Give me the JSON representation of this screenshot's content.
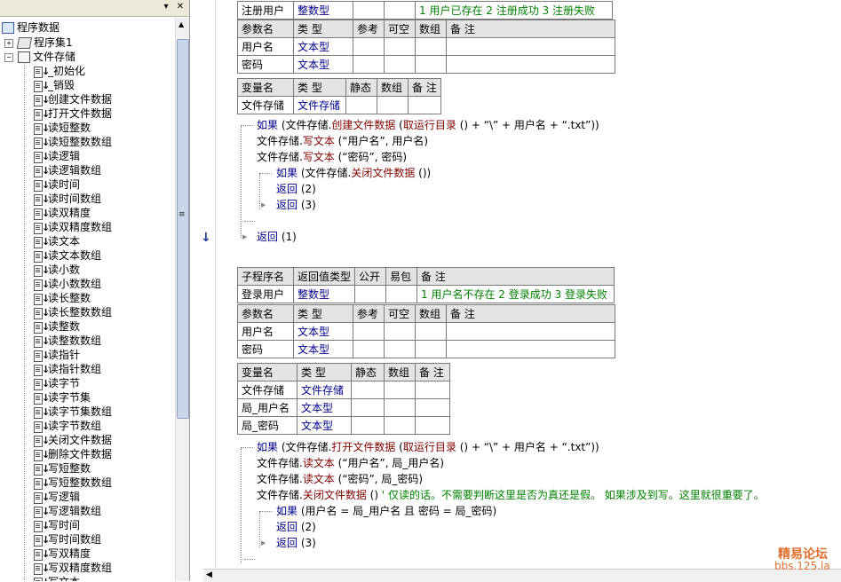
{
  "tree": {
    "root_label": "程序数据",
    "assembly_label": "程序集1",
    "file_storage_label": "文件存储",
    "items": [
      "_初始化",
      "_销毁",
      "创建文件数据",
      "打开文件数据",
      "读短整数",
      "读短整数数组",
      "读逻辑",
      "读逻辑数组",
      "读时间",
      "读时间数组",
      "读双精度",
      "读双精度数组",
      "读文本",
      "读文本数组",
      "读小数",
      "读小数数组",
      "读长整数",
      "读长整数数组",
      "读整数",
      "读整数数组",
      "读指针",
      "读指针数组",
      "读字节",
      "读字节集",
      "读字节集数组",
      "读字节数组",
      "关闭文件数据",
      "删除文件数据",
      "写短整数",
      "写短整数数组",
      "写逻辑",
      "写逻辑数组",
      "写时间",
      "写时间数组",
      "写双精度",
      "写双精度数组",
      "写文本"
    ]
  },
  "sub1": {
    "row_name": "注册用户",
    "row_type": "整数型",
    "row_note": "1 用户已存在  2 注册成功  3 注册失败",
    "param_headers": [
      "参数名",
      "类 型",
      "参考",
      "可空",
      "数组",
      "备 注"
    ],
    "params": [
      [
        "用户名",
        "文本型"
      ],
      [
        "密码",
        "文本型"
      ]
    ],
    "var_headers": [
      "变量名",
      "类 型",
      "静态",
      "数组",
      "备 注"
    ],
    "vars": [
      [
        "文件存储",
        "文件存储"
      ]
    ],
    "code": {
      "l1_kw": "如果",
      "l1_a": "(文件存储.",
      "l1_fn": "创建文件数据",
      "l1_b": " (",
      "l1_fn2": "取运行目录",
      "l1_c": " () + “\\” + 用户名 + “.txt”))",
      "l2_a": "文件存储.",
      "l2_fn": "写文本",
      "l2_b": " (“用户名”, 用户名)",
      "l3_a": "文件存储.",
      "l3_fn": "写文本",
      "l3_b": " (“密码”, 密码)",
      "l4_kw": "如果",
      "l4_a": " (文件存储.",
      "l4_fn": "关闭文件数据",
      "l4_b": " ())",
      "l5_kw": "返回",
      "l5_a": " (2)",
      "l6_kw": "返回",
      "l6_a": " (3)",
      "l7_kw": "返回",
      "l7_a": " (1)"
    }
  },
  "sub2": {
    "header": [
      "子程序名",
      "返回值类型",
      "公开",
      "易包",
      "备 注"
    ],
    "row_name": "登录用户",
    "row_type": "整数型",
    "row_note": "1 用户名不存在 2 登录成功 3 登录失败",
    "param_headers": [
      "参数名",
      "类 型",
      "参考",
      "可空",
      "数组",
      "备 注"
    ],
    "params": [
      [
        "用户名",
        "文本型"
      ],
      [
        "密码",
        "文本型"
      ]
    ],
    "var_headers": [
      "变量名",
      "类 型",
      "静态",
      "数组",
      "备 注"
    ],
    "vars": [
      [
        "文件存储",
        "文件存储"
      ],
      [
        "局_用户名",
        "文本型"
      ],
      [
        "局_密码",
        "文本型"
      ]
    ],
    "code": {
      "l1_kw": "如果",
      "l1_a": "(文件存储.",
      "l1_fn": "打开文件数据",
      "l1_b": " (",
      "l1_fn2": "取运行目录",
      "l1_c": " () + “\\” + 用户名 + “.txt”))",
      "l2_a": "文件存储.",
      "l2_fn": "读文本",
      "l2_b": " (“用户名”, 局_用户名)",
      "l3_a": "文件存储.",
      "l3_fn": "读文本",
      "l3_b": " (“密码”, 局_密码)",
      "l4_a": "文件存储.",
      "l4_fn": "关闭文件数据",
      "l4_b": " () ",
      "l4_cm": "' 仅读的话。不需要判断这里是否为真还是假。 如果涉及到写。这里就很重要了。",
      "l5_kw": "如果",
      "l5_a": " (用户名 = 局_用户名 且 密码 = 局_密码)",
      "l6_kw": "返回",
      "l6_a": " (2)",
      "l7_kw": "返回",
      "l7_a": " (3)"
    }
  },
  "watermark": {
    "line1": "精易论坛",
    "line2": "bbs.125.la"
  },
  "colors": {
    "keyword": "#00008b",
    "function": "#800000",
    "note": "#008000",
    "header_bg": "#e4e4e4"
  }
}
